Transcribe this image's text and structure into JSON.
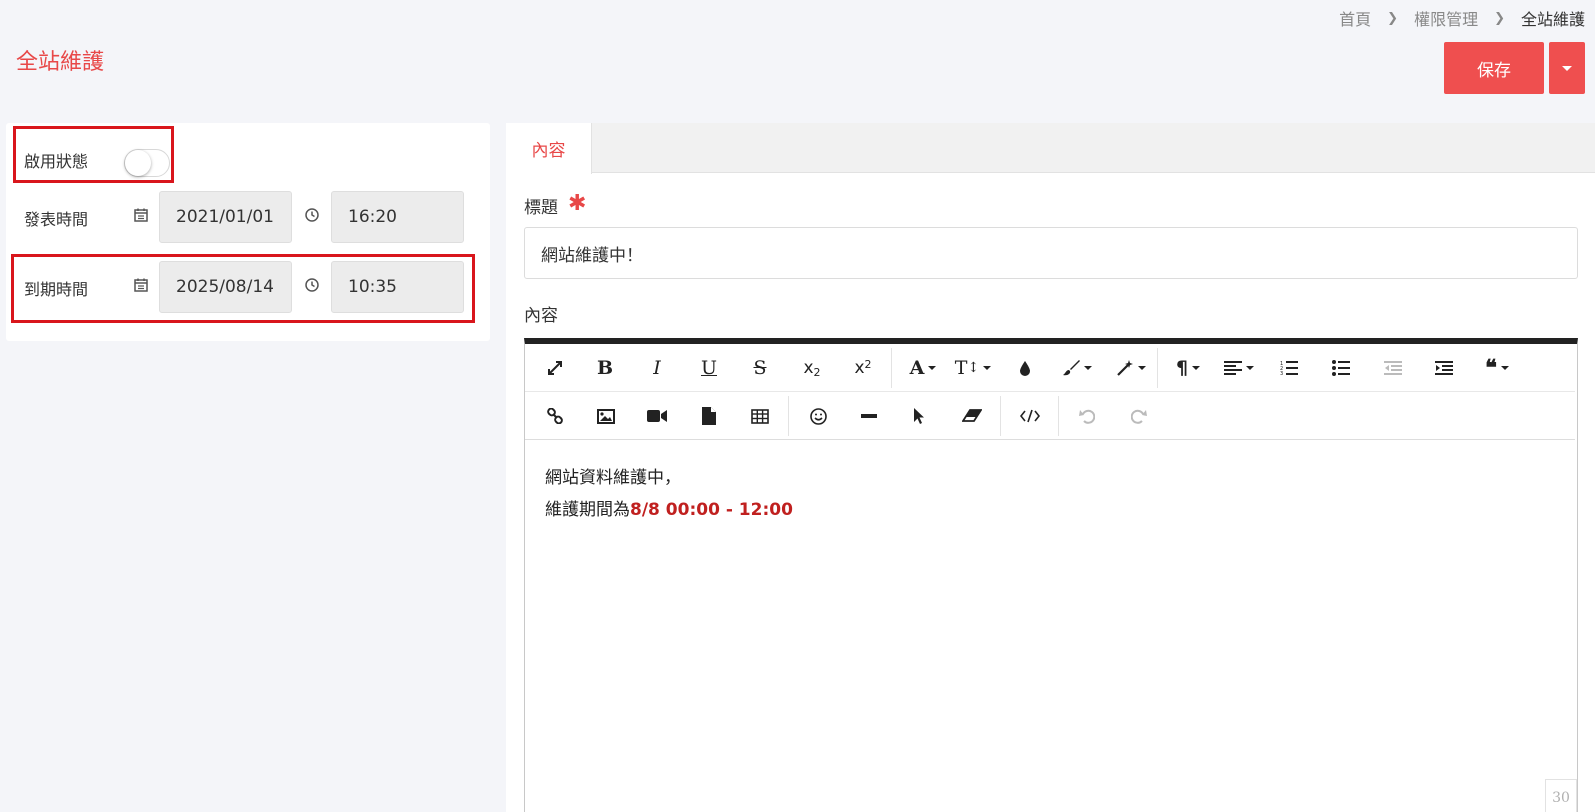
{
  "breadcrumb": {
    "home": "首頁",
    "section": "權限管理",
    "current": "全站維護"
  },
  "page_title": "全站維護",
  "actions": {
    "save_label": "保存"
  },
  "settings": {
    "enabled_label": "啟用狀態",
    "enabled": false,
    "publish_label": "發表時間",
    "publish_date": "2021/01/01",
    "publish_time": "16:20",
    "expire_label": "到期時間",
    "expire_date": "2025/08/14",
    "expire_time": "10:35"
  },
  "tabs": [
    {
      "label": "內容",
      "active": true
    }
  ],
  "form": {
    "title_label": "標題",
    "required_mark": "✱",
    "title_value": "網站維護中！",
    "content_label": "內容"
  },
  "editor": {
    "line1": "網站資料維護中，",
    "line2_prefix": "維護期間為",
    "line2_highlight": "8/8 00:00 - 12:00",
    "char_count": "30",
    "toolbar_row1": [
      "fullscreen-icon",
      "bold-icon",
      "italic-icon",
      "underline-icon",
      "strikethrough-icon",
      "subscript-icon",
      "superscript-icon",
      "font-family-icon",
      "font-size-icon",
      "text-color-icon",
      "background-color-icon",
      "style-icon",
      "paragraph-format-icon",
      "align-icon",
      "ordered-list-icon",
      "unordered-list-icon",
      "outdent-icon",
      "indent-icon",
      "quote-icon"
    ],
    "toolbar_row2": [
      "link-icon",
      "image-icon",
      "video-icon",
      "file-icon",
      "table-icon",
      "emoticon-icon",
      "horizontal-line-icon",
      "select-all-icon",
      "clear-format-icon",
      "code-view-icon",
      "undo-icon",
      "redo-icon"
    ]
  },
  "colors": {
    "accent": "#e84848",
    "highlight_box": "#d9161c",
    "emphasis_text": "#c0201f"
  }
}
